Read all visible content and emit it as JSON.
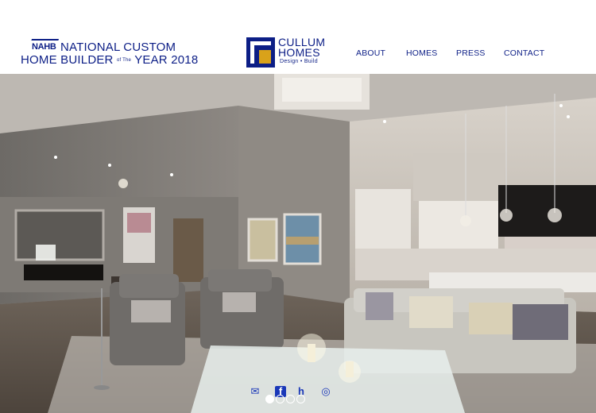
{
  "award": {
    "nahb": "NAHB",
    "line1": "NATIONAL CUSTOM",
    "line2_a": "HOME BUILDER",
    "line2_small": "of The",
    "line2_b": "YEAR 2018"
  },
  "logo": {
    "line1": "CULLUM",
    "line2": "HOMES",
    "tagline": "Design • Build"
  },
  "nav": [
    "ABOUT",
    "HOMES",
    "PRESS",
    "CONTACT"
  ],
  "social": [
    {
      "icon": "email-icon",
      "glyph": "✉"
    },
    {
      "icon": "facebook-icon",
      "glyph": "f"
    },
    {
      "icon": "houzz-icon",
      "glyph": "h"
    },
    {
      "icon": "instagram-icon",
      "glyph": "◎"
    }
  ],
  "slider": {
    "count": 4,
    "active": 0
  },
  "colors": {
    "brand_blue": "#0c1e86",
    "brand_gold": "#d9a21a",
    "icon_blue": "#1a38b8"
  }
}
